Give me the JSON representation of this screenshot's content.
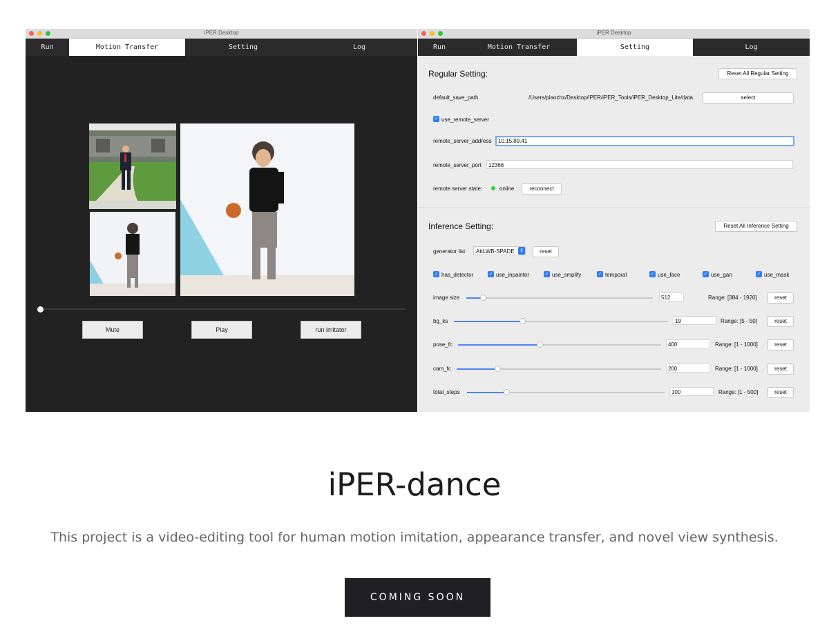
{
  "left_window": {
    "title": "iPER Desktop",
    "tabs": [
      "Run",
      "Motion Transfer",
      "Setting",
      "Log"
    ],
    "active_tab": "Motion Transfer",
    "buttons": {
      "mute": "Mute",
      "play": "Play",
      "run": "run imitator"
    },
    "playback_progress": 0
  },
  "right_window": {
    "title": "iPER Desktop",
    "tabs": [
      "Run",
      "Motion Transfer",
      "Setting",
      "Log"
    ],
    "active_tab": "Setting",
    "regular": {
      "header": "Regular Setting:",
      "reset_label": "Reset All Regular Setting",
      "save_path_label": "default_save_path",
      "save_path_value": "/Users/piaozhx/Desktop/iPER/iPER_Tools/iPER_Desktop_Lite/data",
      "select_label": "select",
      "use_remote_label": "use_remote_server",
      "use_remote_checked": true,
      "address_label": "remote_server_address",
      "address_value": "10.15.89.41",
      "port_label": "remote_server_port",
      "port_value": "12366",
      "state_label": "remote server state:",
      "state_value": "online",
      "state_color": "#2bd13e",
      "reconnect_label": "reconnect"
    },
    "inference": {
      "header": "Inference Setting:",
      "reset_label": "Reset All Inference Setting",
      "generator_label": "generator list",
      "generator_value": "AttLWB-SPADE",
      "generator_reset": "reset",
      "checkboxes": [
        {
          "label": "has_detector",
          "checked": true
        },
        {
          "label": "use_inpaintor",
          "checked": true
        },
        {
          "label": "use_smplify",
          "checked": true
        },
        {
          "label": "temporal",
          "checked": true
        },
        {
          "label": "use_face",
          "checked": true
        },
        {
          "label": "use_gan",
          "checked": true
        },
        {
          "label": "use_mask",
          "checked": true
        }
      ],
      "sliders": [
        {
          "name": "image size",
          "value": "512",
          "range": "Range: [384 - 1920]",
          "reset": "reset",
          "level": 0.09
        },
        {
          "name": "bg_ks",
          "value": "19",
          "range": "Range: [5 - 50]",
          "reset": "reset",
          "level": 0.32
        },
        {
          "name": "pose_fc",
          "value": "400",
          "range": "Range: [1 - 1000]",
          "reset": "reset",
          "level": 0.4
        },
        {
          "name": "cam_fc",
          "value": "200",
          "range": "Range: [1 - 1000]",
          "reset": "reset",
          "level": 0.2
        },
        {
          "name": "total_steps",
          "value": "100",
          "range": "Range: [1 - 500]",
          "reset": "reset",
          "level": 0.2
        }
      ]
    }
  },
  "page": {
    "heading": "iPER-dance",
    "description": "This project is a video-editing tool for human motion imitation, appearance transfer, and novel view synthesis.",
    "cta": "COMING SOON"
  },
  "colors": {
    "accent": "#2f7cf6",
    "cta_bg": "#1f1f24",
    "online": "#2bd13e"
  }
}
